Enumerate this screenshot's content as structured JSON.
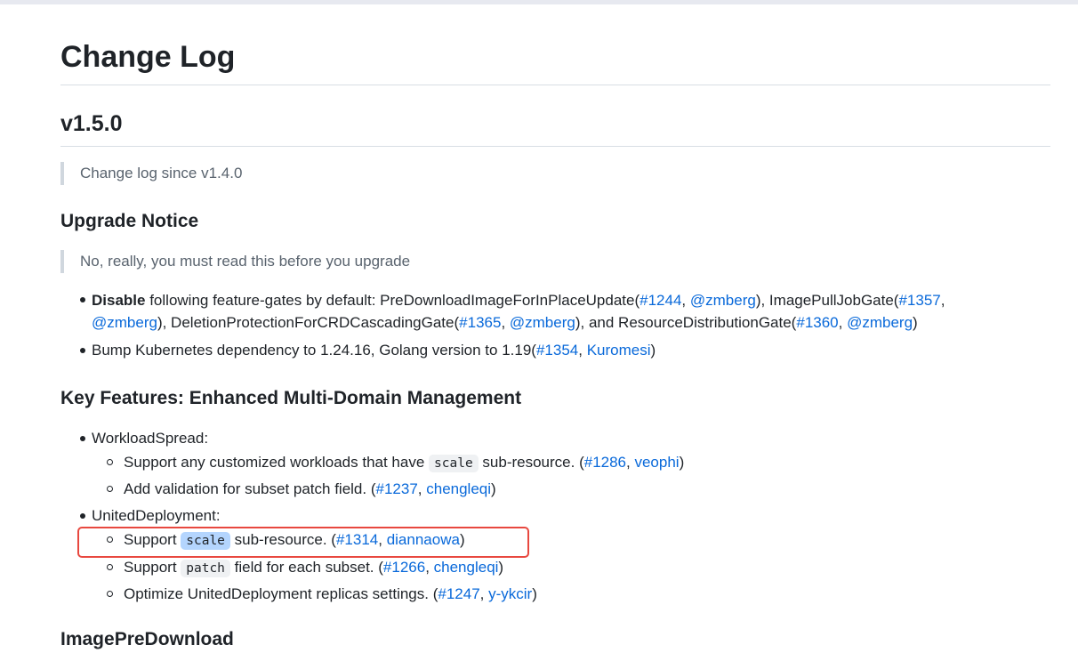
{
  "title": "Change Log",
  "version": "v1.5.0",
  "since_note": "Change log since v1.4.0",
  "upgrade": {
    "heading": "Upgrade Notice",
    "note": "No, really, you must read this before you upgrade",
    "item1": {
      "bold": "Disable",
      "text_a": " following feature-gates by default: PreDownloadImageForInPlaceUpdate(",
      "link_1244": "#1244",
      "sep": ", ",
      "user_zmberg_1": "@zmberg",
      "text_b": "), ImagePullJobGate(",
      "link_1357": "#1357",
      "comma": ",",
      "user_zmberg_2": "@zmberg",
      "text_c": "), DeletionProtectionForCRDCascadingGate(",
      "link_1365": "#1365",
      "user_zmberg_3": "@zmberg",
      "text_d": "), and ResourceDistributionGate(",
      "link_1360": "#1360",
      "user_zmberg_4": "@zmberg",
      "close": ")"
    },
    "item2": {
      "text": "Bump Kubernetes dependency to 1.24.16, Golang version to 1.19(",
      "link_1354": "#1354",
      "user": "Kuromesi",
      "close": ")"
    }
  },
  "features": {
    "heading": "Key Features: Enhanced Multi-Domain Management",
    "workloadspread": {
      "label": "WorkloadSpread:",
      "sub1": {
        "text_a": "Support any customized workloads that have ",
        "code": "scale",
        "text_b": " sub-resource. (",
        "link": "#1286",
        "user": "veophi",
        "close": ")"
      },
      "sub2": {
        "text_a": "Add validation for subset patch field. (",
        "link": "#1237",
        "user": "chengleqi",
        "close": ")"
      }
    },
    "uniteddeployment": {
      "label": "UnitedDeployment:",
      "sub1": {
        "text_a": "Support ",
        "code": "scale",
        "text_b": " sub-resource. (",
        "link": "#1314",
        "user": "diannaowa",
        "close": ")"
      },
      "sub2": {
        "text_a": "Support ",
        "code": "patch",
        "text_b": " field for each subset. (",
        "link": "#1266",
        "user": "chengleqi",
        "close": ")"
      },
      "sub3": {
        "text_a": "Optimize UnitedDeployment replicas settings. (",
        "link": "#1247",
        "user": "y-ykcir",
        "close": ")"
      }
    }
  },
  "next_heading": "ImagePreDownload",
  "colors": {
    "link": "#0969da",
    "text": "#1f2328",
    "highlight_box": "#e8483f",
    "selection": "#b4d5fe"
  }
}
